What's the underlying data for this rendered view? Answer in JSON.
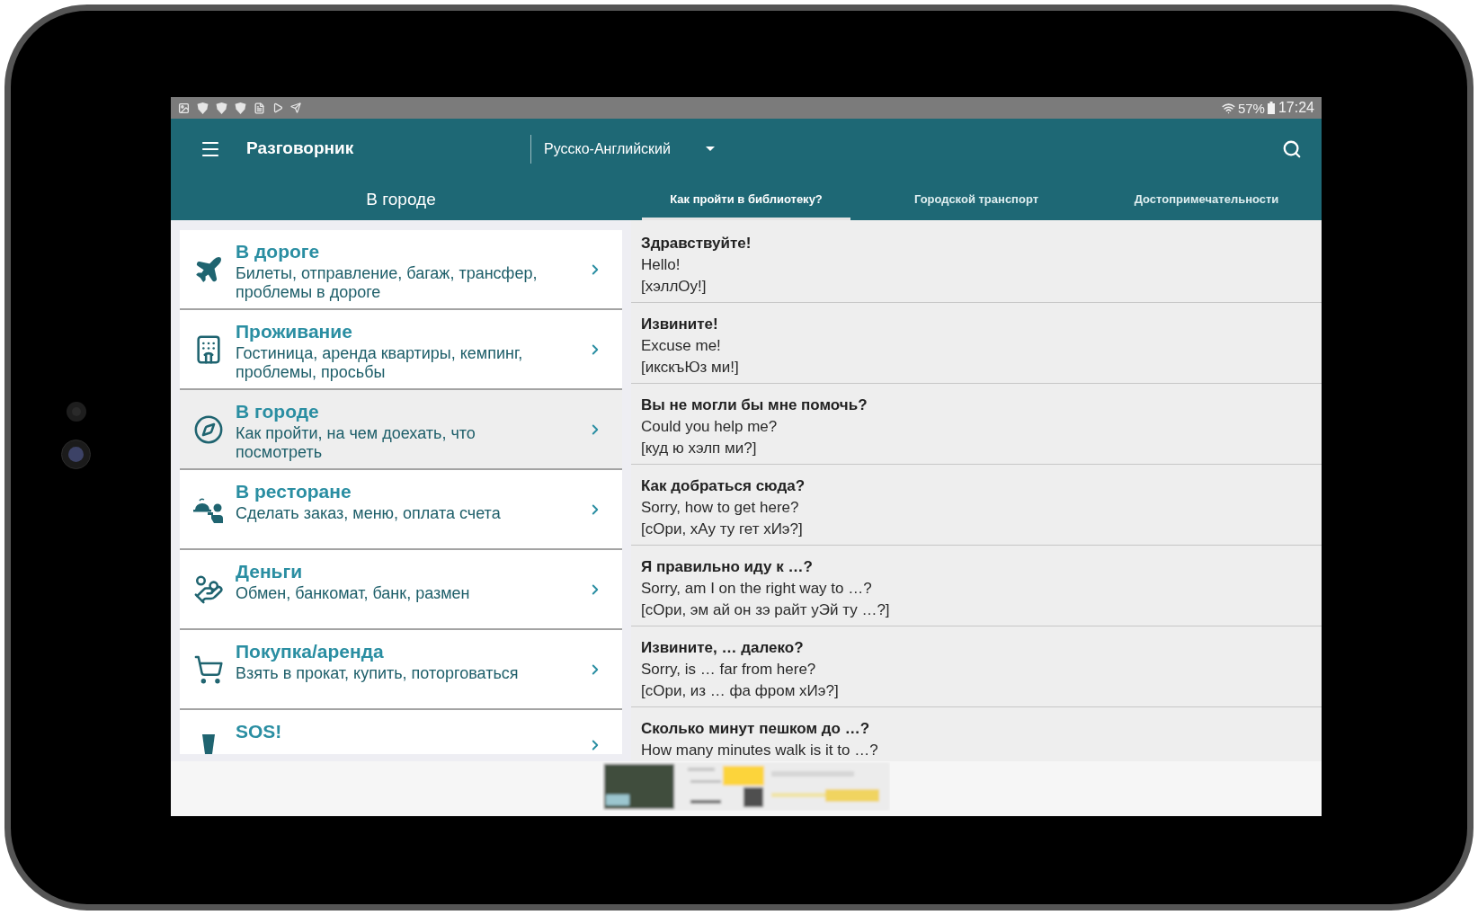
{
  "status_bar": {
    "battery": "57%",
    "time": "17:24"
  },
  "toolbar": {
    "title": "Разговорник",
    "language": "Русско-Английский"
  },
  "tab_row": {
    "section_title": "В городе",
    "tabs": [
      {
        "label": "Как пройти в библиотеку?",
        "selected": true
      },
      {
        "label": "Городской транспорт",
        "selected": false
      },
      {
        "label": "Достопримечательности",
        "selected": false
      }
    ]
  },
  "categories": [
    {
      "kind": "plane",
      "title": "В дороге",
      "subtitle": "Билеты, отправление, багаж, трансфер, проблемы в дороге",
      "selected": false
    },
    {
      "kind": "hotel",
      "title": "Проживание",
      "subtitle": "Гостиница, аренда квартиры, кемпинг, проблемы, просьбы",
      "selected": false
    },
    {
      "kind": "compass",
      "title": "В городе",
      "subtitle": "Как пройти, на чем доехать, что посмотреть",
      "selected": true
    },
    {
      "kind": "waiter",
      "title": "В ресторане",
      "subtitle": "Сделать заказ, меню, оплата счета",
      "selected": false
    },
    {
      "kind": "money",
      "title": "Деньги",
      "subtitle": "Обмен, банкомат, банк, размен",
      "selected": false
    },
    {
      "kind": "cart",
      "title": "Покупка/аренда",
      "subtitle": "Взять в прокат, купить, поторговаться",
      "selected": false
    },
    {
      "kind": "exclamation",
      "title": "SOS!",
      "selected": false
    }
  ],
  "phrases": [
    {
      "phrase": "Здравствуйте!",
      "translation": "Hello!",
      "transcription": "[хэллОу!]"
    },
    {
      "phrase": "Извините!",
      "translation": "Excuse me!",
      "transcription": "[икскъЮз ми!]"
    },
    {
      "phrase": "Вы не могли бы мне помочь?",
      "translation": "Could you help me?",
      "transcription": "[куд ю хэлп ми?]"
    },
    {
      "phrase": "Как добраться сюда?",
      "translation": "Sorry, how to get here?",
      "transcription": "[сОри, хАу ту гет хИэ?]"
    },
    {
      "phrase": "Я правильно иду к …?",
      "translation": "Sorry, am I on the right way to …?",
      "transcription": "[сОри, эм ай он зэ райт уЭй ту …?]"
    },
    {
      "phrase": "Извините, … далеко?",
      "translation": "Sorry, is … far from here?",
      "transcription": "[сОри, из … фа фром хИэ?]"
    },
    {
      "phrase": "Сколько минут пешком до …?",
      "translation": "How many minutes walk is it to …?"
    }
  ]
}
